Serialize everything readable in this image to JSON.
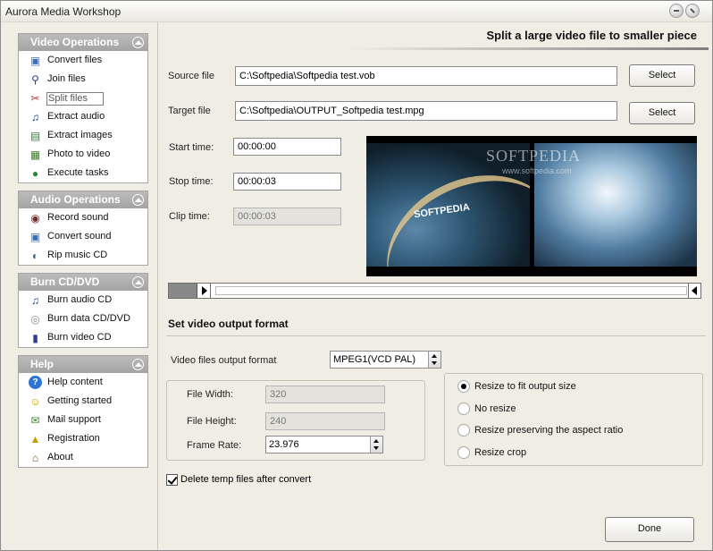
{
  "app": {
    "title": "Aurora Media Workshop"
  },
  "sidebar": {
    "groups": [
      {
        "title": "Video Operations",
        "items": [
          {
            "label": "Convert files",
            "icon": "convert-icon"
          },
          {
            "label": "Join files",
            "icon": "join-icon"
          },
          {
            "label": "Split files",
            "icon": "scissors-icon"
          },
          {
            "label": "Extract audio",
            "icon": "music-note-icon"
          },
          {
            "label": "Extract images",
            "icon": "image-icon"
          },
          {
            "label": "Photo to video",
            "icon": "photo-icon"
          },
          {
            "label": "Execute tasks",
            "icon": "execute-icon"
          }
        ]
      },
      {
        "title": "Audio Operations",
        "items": [
          {
            "label": "Record sound",
            "icon": "record-icon"
          },
          {
            "label": "Convert sound",
            "icon": "convert-sound-icon"
          },
          {
            "label": "Rip music CD",
            "icon": "rip-cd-icon"
          }
        ]
      },
      {
        "title": "Burn CD/DVD",
        "items": [
          {
            "label": "Burn audio CD",
            "icon": "audio-cd-icon"
          },
          {
            "label": "Burn data CD/DVD",
            "icon": "data-cd-icon"
          },
          {
            "label": "Burn video CD",
            "icon": "video-cd-icon"
          }
        ]
      },
      {
        "title": "Help",
        "items": [
          {
            "label": "Help content",
            "icon": "help-icon"
          },
          {
            "label": "Getting started",
            "icon": "smiley-icon"
          },
          {
            "label": "Mail support",
            "icon": "mail-icon"
          },
          {
            "label": "Registration",
            "icon": "lock-icon"
          },
          {
            "label": "About",
            "icon": "home-icon"
          }
        ]
      }
    ]
  },
  "main": {
    "heading": "Split a large video file to smaller piece",
    "source_label": "Source file",
    "source_value": "C:\\Softpedia\\Softpedia test.vob",
    "target_label": "Target file",
    "target_value": "C:\\Softpedia\\OUTPUT_Softpedia test.mpg",
    "select_label": "Select",
    "start_label": "Start time:",
    "start_value": "00:00:00",
    "stop_label": "Stop time:",
    "stop_value": "00:00:03",
    "clip_label": "Clip time:",
    "clip_value": "00:00:03",
    "watermark": "SOFTPEDIA",
    "watermark_url": "www.softpedia.com",
    "frame_logo": "SOFTPEDIA"
  },
  "output": {
    "section_title": "Set video output format",
    "format_label": "Video files output format",
    "format_value": "MPEG1(VCD PAL)",
    "width_label": "File Width:",
    "width_value": "320",
    "height_label": "File Height:",
    "height_value": "240",
    "rate_label": "Frame Rate:",
    "rate_value": "23.976",
    "radios": [
      {
        "label": "Resize to fit output size",
        "selected": true
      },
      {
        "label": "No resize",
        "selected": false
      },
      {
        "label": "Resize preserving the aspect ratio",
        "selected": false
      },
      {
        "label": "Resize crop",
        "selected": false
      }
    ],
    "delete_temp_label": "Delete temp files after convert",
    "delete_temp_checked": true,
    "done_label": "Done"
  }
}
